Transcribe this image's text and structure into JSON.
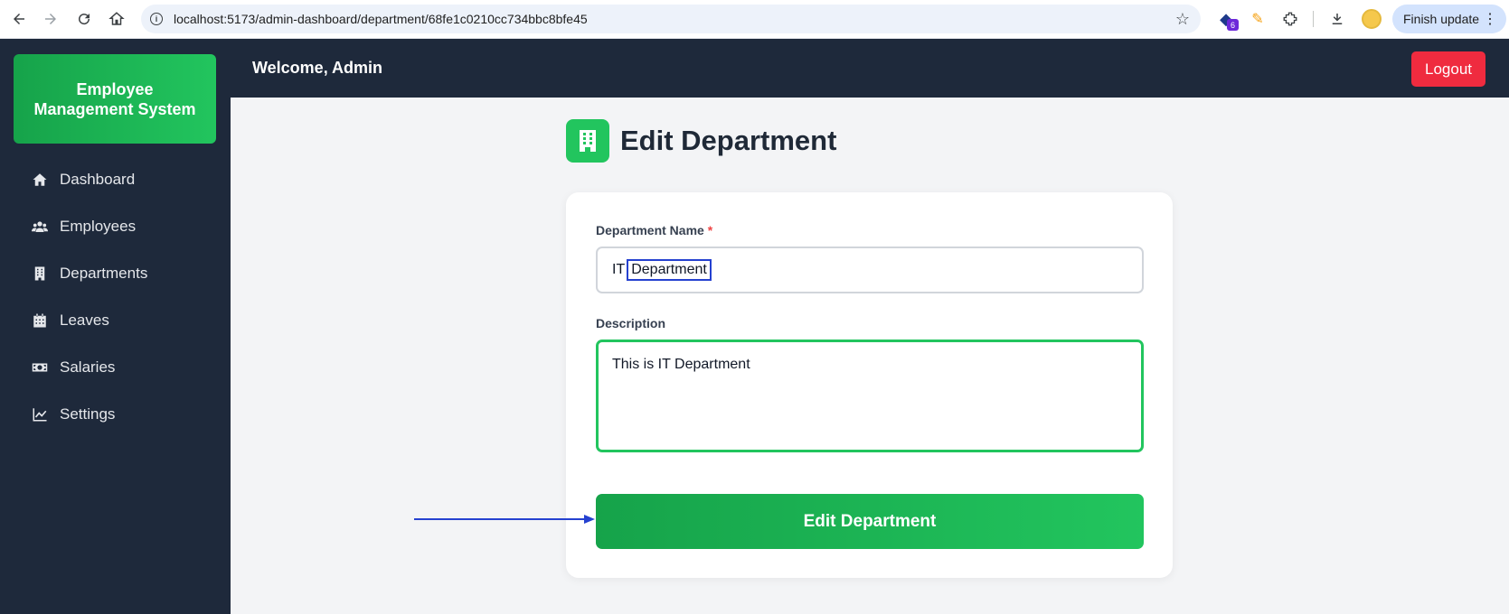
{
  "browser": {
    "url": "localhost:5173/admin-dashboard/department/68fe1c0210cc734bbc8bfe45",
    "extension_badge": "6",
    "update_label": "Finish update"
  },
  "sidebar": {
    "brand": "Employee Management System",
    "items": [
      {
        "label": "Dashboard",
        "icon": "home-icon"
      },
      {
        "label": "Employees",
        "icon": "users-icon"
      },
      {
        "label": "Departments",
        "icon": "building-icon"
      },
      {
        "label": "Leaves",
        "icon": "calendar-icon"
      },
      {
        "label": "Salaries",
        "icon": "money-icon"
      },
      {
        "label": "Settings",
        "icon": "chart-line-icon"
      }
    ]
  },
  "header": {
    "welcome": "Welcome, Admin",
    "logout_label": "Logout"
  },
  "page": {
    "title": "Edit Department",
    "title_icon": "building-icon"
  },
  "form": {
    "name_label": "Department Name",
    "required_mark": "*",
    "name_value_prefix": "IT",
    "name_value_highlight": "Department",
    "description_label": "Description",
    "description_value": "This is IT Department",
    "submit_label": "Edit Department"
  },
  "colors": {
    "primary": "#22c55e",
    "sidebar": "#1e293b",
    "danger": "#ef2b3f",
    "annotation": "#2541d0"
  }
}
